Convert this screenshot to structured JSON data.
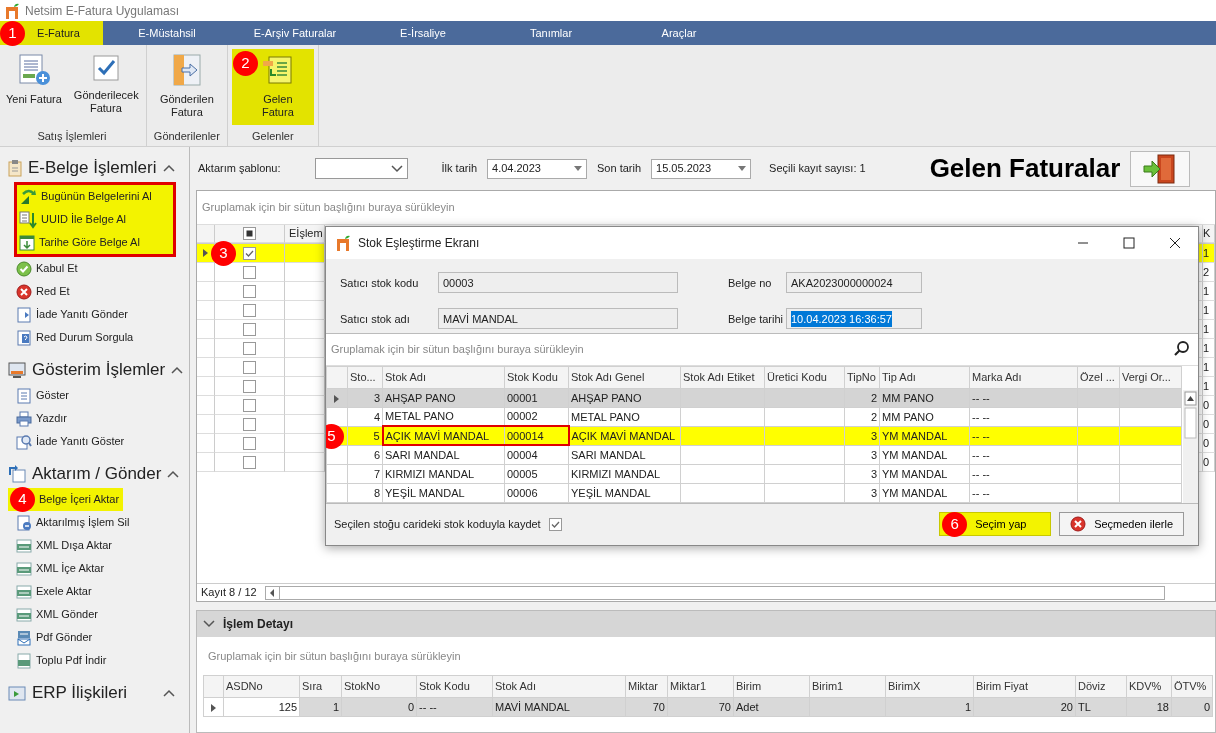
{
  "window": {
    "title": "Netsim E-Fatura Uygulaması"
  },
  "tabs": [
    {
      "label": "E-Fatura",
      "selected": true,
      "highlighted": true,
      "marker": "1"
    },
    {
      "label": "E-Müstahsil",
      "selected": false,
      "highlighted": false
    },
    {
      "label": "E-Arşiv Faturalar",
      "selected": false,
      "highlighted": false
    },
    {
      "label": "E-İrsaliye",
      "selected": false,
      "highlighted": false
    },
    {
      "label": "Tanımlar",
      "selected": false,
      "highlighted": false
    },
    {
      "label": "Araçlar",
      "selected": false,
      "highlighted": false
    }
  ],
  "ribbon_groups": [
    {
      "label": "Satış İşlemleri",
      "buttons": [
        {
          "label": "Yeni Fatura",
          "highlighted": false
        },
        {
          "label": "Gönderilecek Fatura",
          "highlighted": false
        }
      ]
    },
    {
      "label": "Gönderilenler",
      "buttons": [
        {
          "label": "Gönderilen Fatura",
          "highlighted": false
        }
      ]
    },
    {
      "label": "Gelenler",
      "buttons": [
        {
          "label": "Gelen Fatura",
          "highlighted": true,
          "marker": "2"
        }
      ]
    }
  ],
  "sidebar": {
    "sections": [
      {
        "title": "E-Belge İşlemleri",
        "expanded": true,
        "items": [
          {
            "label": "Bugünün Belgelerini Al",
            "highlighted": true,
            "framed": true
          },
          {
            "label": "UUID İle Belge Al",
            "highlighted": true,
            "framed": true
          },
          {
            "label": "Tarihe Göre Belge Al",
            "highlighted": true,
            "framed": true
          },
          {
            "label": "Kabul Et",
            "highlighted": false,
            "framed": false
          },
          {
            "label": "Red Et",
            "highlighted": false,
            "framed": false
          },
          {
            "label": "İade Yanıtı Gönder",
            "highlighted": false,
            "framed": false
          },
          {
            "label": "Red Durum Sorgula",
            "highlighted": false,
            "framed": false
          }
        ]
      },
      {
        "title": "Gösterim İşlemler",
        "expanded": true,
        "items": [
          {
            "label": "Göster",
            "highlighted": false,
            "framed": false
          },
          {
            "label": "Yazdır",
            "highlighted": false,
            "framed": false
          },
          {
            "label": "İade Yanıtı Göster",
            "highlighted": false,
            "framed": false
          }
        ]
      },
      {
        "title": "Aktarım / Gönder",
        "expanded": true,
        "items": [
          {
            "label": "Belge İçeri Aktar",
            "highlighted": true,
            "framed": false,
            "marker": "4"
          },
          {
            "label": "Aktarılmış İşlem Sil",
            "highlighted": false,
            "framed": false
          },
          {
            "label": "XML Dışa Aktar",
            "highlighted": false,
            "framed": false
          },
          {
            "label": "XML İçe Aktar",
            "highlighted": false,
            "framed": false
          },
          {
            "label": "Exele Aktar",
            "highlighted": false,
            "framed": false
          },
          {
            "label": "XML Gönder",
            "highlighted": false,
            "framed": false
          },
          {
            "label": "Pdf Gönder",
            "highlighted": false,
            "framed": false
          },
          {
            "label": "Toplu Pdf İndir",
            "highlighted": false,
            "framed": false
          }
        ]
      },
      {
        "title": "ERP İlişkileri",
        "expanded": true
      }
    ]
  },
  "filters": {
    "template_label": "Aktarım şablonu:",
    "start_label": "İlk tarih",
    "start_value": "4.04.2023",
    "end_label": "Son tarih",
    "end_value": "15.05.2023",
    "selected_count": "Seçili kayıt sayısı: 1"
  },
  "page_title": "Gelen Faturalar",
  "main_grid": {
    "group_hint": "Gruplamak için bir sütun başlığını buraya sürükleyin",
    "header_checkbox_partial": true,
    "columns": [
      "Eİşlem",
      "K"
    ],
    "rows": [
      {
        "checked": true,
        "selected": true,
        "current": true,
        "marker": "3",
        "last_cell": "1"
      },
      {
        "checked": false,
        "selected": false,
        "current": false,
        "last_cell": "2"
      },
      {
        "checked": false,
        "selected": false,
        "current": false,
        "last_cell": "1"
      },
      {
        "checked": false,
        "selected": false,
        "current": false,
        "last_cell": "1"
      },
      {
        "checked": false,
        "selected": false,
        "current": false,
        "last_cell": "1"
      },
      {
        "checked": false,
        "selected": false,
        "current": false,
        "last_cell": "1"
      },
      {
        "checked": false,
        "selected": false,
        "current": false,
        "last_cell": "1"
      },
      {
        "checked": false,
        "selected": false,
        "current": false,
        "last_cell": "1"
      },
      {
        "checked": false,
        "selected": false,
        "current": false,
        "last_cell": "0"
      },
      {
        "checked": false,
        "selected": false,
        "current": false,
        "last_cell": "0"
      },
      {
        "checked": false,
        "selected": false,
        "current": false,
        "last_cell": "0"
      },
      {
        "checked": false,
        "selected": false,
        "current": false,
        "last_cell": "0"
      }
    ],
    "footer": "Kayıt 8 / 12"
  },
  "detail": {
    "title": "İşlem Detayı",
    "expanded": true,
    "group_hint": "Gruplamak için bir sütun başlığını buraya sürükleyin",
    "columns": [
      "ASDNo",
      "Sıra",
      "StokNo",
      "Stok Kodu",
      "Stok Adı",
      "Miktar",
      "Miktar1",
      "Birim",
      "Birim1",
      "BirimX",
      "Birim Fiyat",
      "Döviz",
      "KDV%",
      "ÖTV%"
    ],
    "rows": [
      {
        "cells": [
          "125",
          "1",
          "0",
          "-- --",
          "MAVİ MANDAL",
          "70",
          "70",
          "Adet",
          null,
          "1",
          "20",
          "TL",
          "18",
          "0"
        ]
      }
    ]
  },
  "dialog": {
    "title": "Stok Eşleştirme Ekranı",
    "fields": [
      {
        "label": "Satıcı stok kodu",
        "value": "00003",
        "selected": false
      },
      {
        "label": "Satıcı stok adı",
        "value": "MAVİ MANDAL",
        "selected": false
      },
      {
        "label": "Belge no",
        "value": "AKA2023000000024",
        "selected": false
      },
      {
        "label": "Belge tarihi",
        "value": "10.04.2023 16:36:57",
        "selected": true
      }
    ],
    "group_hint": "Gruplamak için bir sütun başlığını buraya sürükleyin",
    "columns": [
      "Sto...",
      "Stok Adı",
      "Stok Kodu",
      "Stok Adı Genel",
      "Stok Adı Etiket",
      "Üretici Kodu",
      "TipNo",
      "Tip Adı",
      "Marka Adı",
      "Özel ...",
      "Vergi Or..."
    ],
    "rows": [
      {
        "cells": [
          "3",
          "AHŞAP PANO",
          "00001",
          "AHŞAP PANO",
          null,
          null,
          "2",
          "MM PANO",
          "-- --",
          null,
          null
        ],
        "focused": true,
        "selected": false,
        "framed": false
      },
      {
        "cells": [
          "4",
          "METAL PANO",
          "00002",
          "METAL PANO",
          null,
          null,
          "2",
          "MM PANO",
          "-- --",
          null,
          null
        ],
        "focused": false,
        "selected": false,
        "framed": false
      },
      {
        "cells": [
          "5",
          "AÇIK MAVİ MANDAL",
          "000014",
          "AÇIK MAVİ MANDAL",
          null,
          null,
          "3",
          "YM MANDAL",
          "-- --",
          null,
          null
        ],
        "focused": false,
        "selected": true,
        "framed": true,
        "marker": "5"
      },
      {
        "cells": [
          "6",
          "SARI MANDAL",
          "00004",
          "SARI MANDAL",
          null,
          null,
          "3",
          "YM MANDAL",
          "-- --",
          null,
          null
        ],
        "focused": false,
        "selected": false,
        "framed": false
      },
      {
        "cells": [
          "7",
          "KIRMIZI MANDAL",
          "00005",
          "KIRMIZI MANDAL",
          null,
          null,
          "3",
          "YM MANDAL",
          "-- --",
          null,
          null
        ],
        "focused": false,
        "selected": false,
        "framed": false
      },
      {
        "cells": [
          "8",
          "YEŞİL MANDAL",
          "00006",
          "YEŞİL MANDAL",
          null,
          null,
          "3",
          "YM MANDAL",
          "-- --",
          null,
          null
        ],
        "focused": false,
        "selected": false,
        "framed": false
      }
    ],
    "save_option": {
      "label": "Seçilen stoğu carideki stok koduyla kaydet",
      "checked": true
    },
    "buttons": [
      {
        "label": "Seçim yap",
        "highlighted": true,
        "marker": "6"
      },
      {
        "label": "Seçmeden ilerle",
        "highlighted": false
      }
    ]
  }
}
